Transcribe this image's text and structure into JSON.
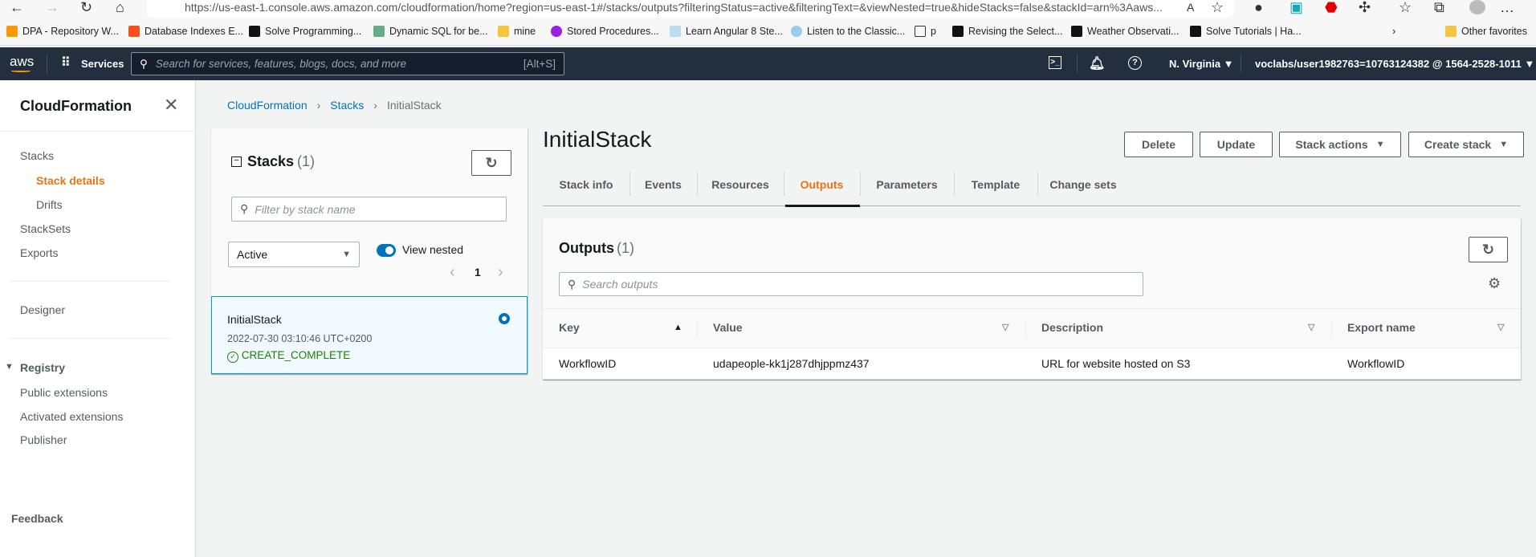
{
  "browser": {
    "url": "https://us-east-1.console.aws.amazon.com/cloudformation/home?region=us-east-1#/stacks/outputs?filteringStatus=active&filteringText=&viewNested=true&hideStacks=false&stackId=arn%3Aaws...",
    "bookmarks": [
      "DPA - Repository W...",
      "Database Indexes E...",
      "Solve Programming...",
      "Dynamic SQL for be...",
      "mine",
      "Stored Procedures...",
      "Learn Angular 8 Ste...",
      "Listen to the Classic...",
      "p",
      "Revising the Select...",
      "Weather Observati...",
      "Solve Tutorials | Ha..."
    ],
    "other_favorites": "Other favorites"
  },
  "nav": {
    "logo": "aws",
    "services": "Services",
    "search_placeholder": "Search for services, features, blogs, docs, and more",
    "search_shortcut": "[Alt+S]",
    "region": "N. Virginia",
    "account": "voclabs/user1982763=10763124382 @ 1564-2528-1011"
  },
  "sidebar": {
    "title": "CloudFormation",
    "items": [
      "Stacks",
      "Stack details",
      "Drifts",
      "StackSets",
      "Exports",
      "Designer"
    ],
    "registry": "Registry",
    "registry_items": [
      "Public extensions",
      "Activated extensions",
      "Publisher"
    ],
    "feedback": "Feedback"
  },
  "breadcrumb": [
    "CloudFormation",
    "Stacks",
    "InitialStack"
  ],
  "stacks_panel": {
    "title": "Stacks",
    "count": "(1)",
    "filter_placeholder": "Filter by stack name",
    "status_filter": "Active",
    "view_nested": "View nested",
    "page": "1",
    "stack": {
      "name": "InitialStack",
      "created": "2022-07-30 03:10:46 UTC+0200",
      "status": "CREATE_COMPLETE"
    }
  },
  "detail": {
    "title": "InitialStack",
    "buttons": {
      "delete": "Delete",
      "update": "Update",
      "stack_actions": "Stack actions",
      "create_stack": "Create stack"
    },
    "tabs": [
      "Stack info",
      "Events",
      "Resources",
      "Outputs",
      "Parameters",
      "Template",
      "Change sets"
    ],
    "active_tab": "Outputs"
  },
  "outputs": {
    "title": "Outputs",
    "count": "(1)",
    "search_placeholder": "Search outputs",
    "columns": [
      "Key",
      "Value",
      "Description",
      "Export name"
    ],
    "rows": [
      {
        "key": "WorkflowID",
        "value": "udapeople-kk1j287dhjppmz437",
        "description": "URL for website hosted on S3",
        "export": "WorkflowID"
      }
    ]
  },
  "colors": {
    "accent": "#ec7211",
    "link": "#0073bb",
    "success": "#1d8102",
    "nav": "#232f3e"
  }
}
